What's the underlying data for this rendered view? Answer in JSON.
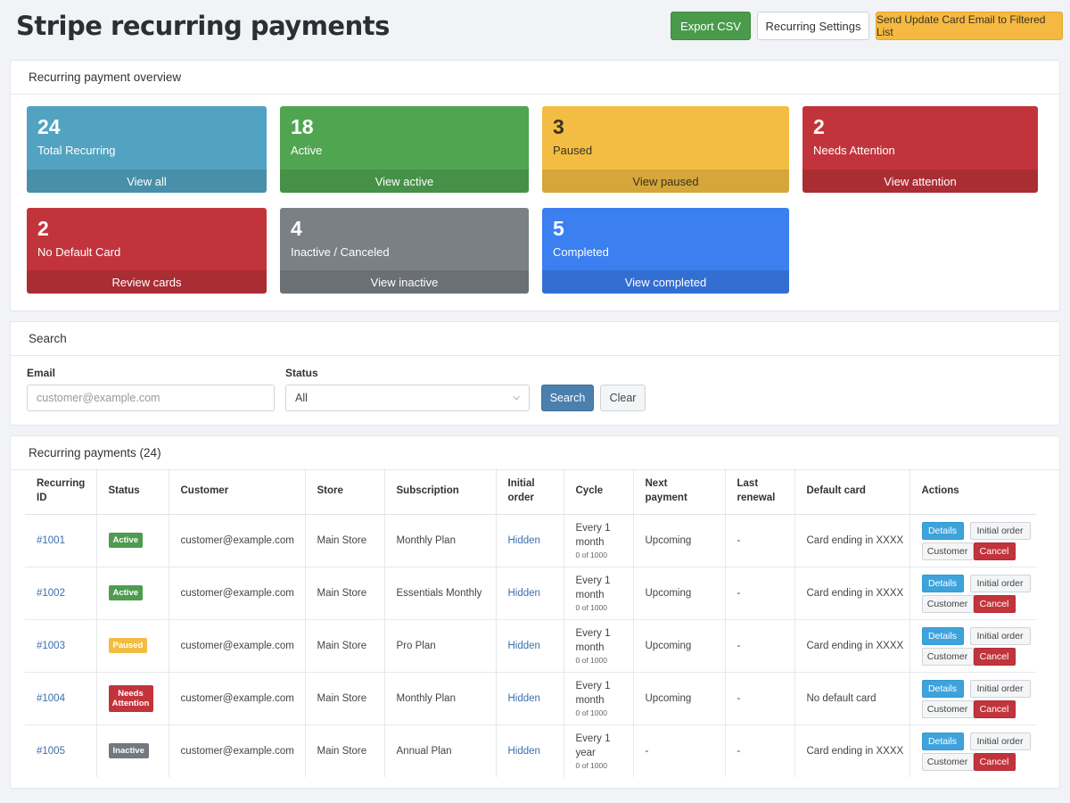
{
  "header": {
    "title": "Stripe recurring payments",
    "export_label": "Export CSV",
    "settings_label": "Recurring Settings",
    "send_email_label": "Send Update Card Email to Filtered List"
  },
  "overview": {
    "title": "Recurring payment overview",
    "cards": [
      {
        "count": "24",
        "label": "Total Recurring",
        "link": "View all",
        "color": "#52a3c1"
      },
      {
        "count": "18",
        "label": "Active",
        "link": "View active",
        "color": "#50a551"
      },
      {
        "count": "3",
        "label": "Paused",
        "link": "View paused",
        "color": "#f3bd43"
      },
      {
        "count": "2",
        "label": "Needs Attention",
        "link": "View attention",
        "color": "#c2343c"
      },
      {
        "count": "2",
        "label": "No Default Card",
        "link": "Review cards",
        "color": "#c2343c"
      },
      {
        "count": "4",
        "label": "Inactive / Canceled",
        "link": "View inactive",
        "color": "#7a8086"
      },
      {
        "count": "5",
        "label": "Completed",
        "link": "View completed",
        "color": "#3b7ff0"
      }
    ]
  },
  "search": {
    "title": "Search",
    "email_label": "Email",
    "email_placeholder": "customer@example.com",
    "status_label": "Status",
    "status_value": "All",
    "search_label": "Search",
    "clear_label": "Clear"
  },
  "table": {
    "title": "Recurring payments (24)",
    "headers": {
      "id_1": "Recurring",
      "id_2": "ID",
      "status": "Status",
      "customer": "Customer",
      "store": "Store",
      "subscription": "Subscription",
      "initial_1": "Initial",
      "initial_2": "order",
      "cycle": "Cycle",
      "next_1": "Next",
      "next_2": "payment",
      "last_1": "Last",
      "last_2": "renewal",
      "card": "Default card",
      "actions": "Actions"
    },
    "actions": {
      "details": "Details",
      "initial": "Initial order",
      "customer": "Customer",
      "cancel": "Cancel"
    },
    "rows": [
      {
        "id": "#1001",
        "status": "Active",
        "status_line2": "",
        "customer": "customer@example.com",
        "store": "Main Store",
        "subscription": "Monthly Plan",
        "initial": "Hidden",
        "cycle_1": "Every 1",
        "cycle_2": "month",
        "cycle_count": "0 of 1000",
        "next": "Upcoming",
        "last": "-",
        "card": "Card ending in XXXX"
      },
      {
        "id": "#1002",
        "status": "Active",
        "status_line2": "",
        "customer": "customer@example.com",
        "store": "Main Store",
        "subscription": "Essentials Monthly",
        "initial": "Hidden",
        "cycle_1": "Every 1",
        "cycle_2": "month",
        "cycle_count": "0 of 1000",
        "next": "Upcoming",
        "last": "-",
        "card": "Card ending in XXXX"
      },
      {
        "id": "#1003",
        "status": "Paused",
        "status_line2": "",
        "customer": "customer@example.com",
        "store": "Main Store",
        "subscription": "Pro Plan",
        "initial": "Hidden",
        "cycle_1": "Every 1",
        "cycle_2": "month",
        "cycle_count": "0 of 1000",
        "next": "Upcoming",
        "last": "-",
        "card": "Card ending in XXXX"
      },
      {
        "id": "#1004",
        "status": "Needs",
        "status_line2": "Attention",
        "customer": "customer@example.com",
        "store": "Main Store",
        "subscription": "Monthly Plan",
        "initial": "Hidden",
        "cycle_1": "Every 1",
        "cycle_2": "month",
        "cycle_count": "0 of 1000",
        "next": "Upcoming",
        "last": "-",
        "card": "No default card"
      },
      {
        "id": "#1005",
        "status": "Inactive",
        "status_line2": "",
        "customer": "customer@example.com",
        "store": "Main Store",
        "subscription": "Annual Plan",
        "initial": "Hidden",
        "cycle_1": "Every 1",
        "cycle_2": "year",
        "cycle_count": "0 of 1000",
        "next": "-",
        "last": "-",
        "card": "Card ending in XXXX"
      }
    ]
  }
}
